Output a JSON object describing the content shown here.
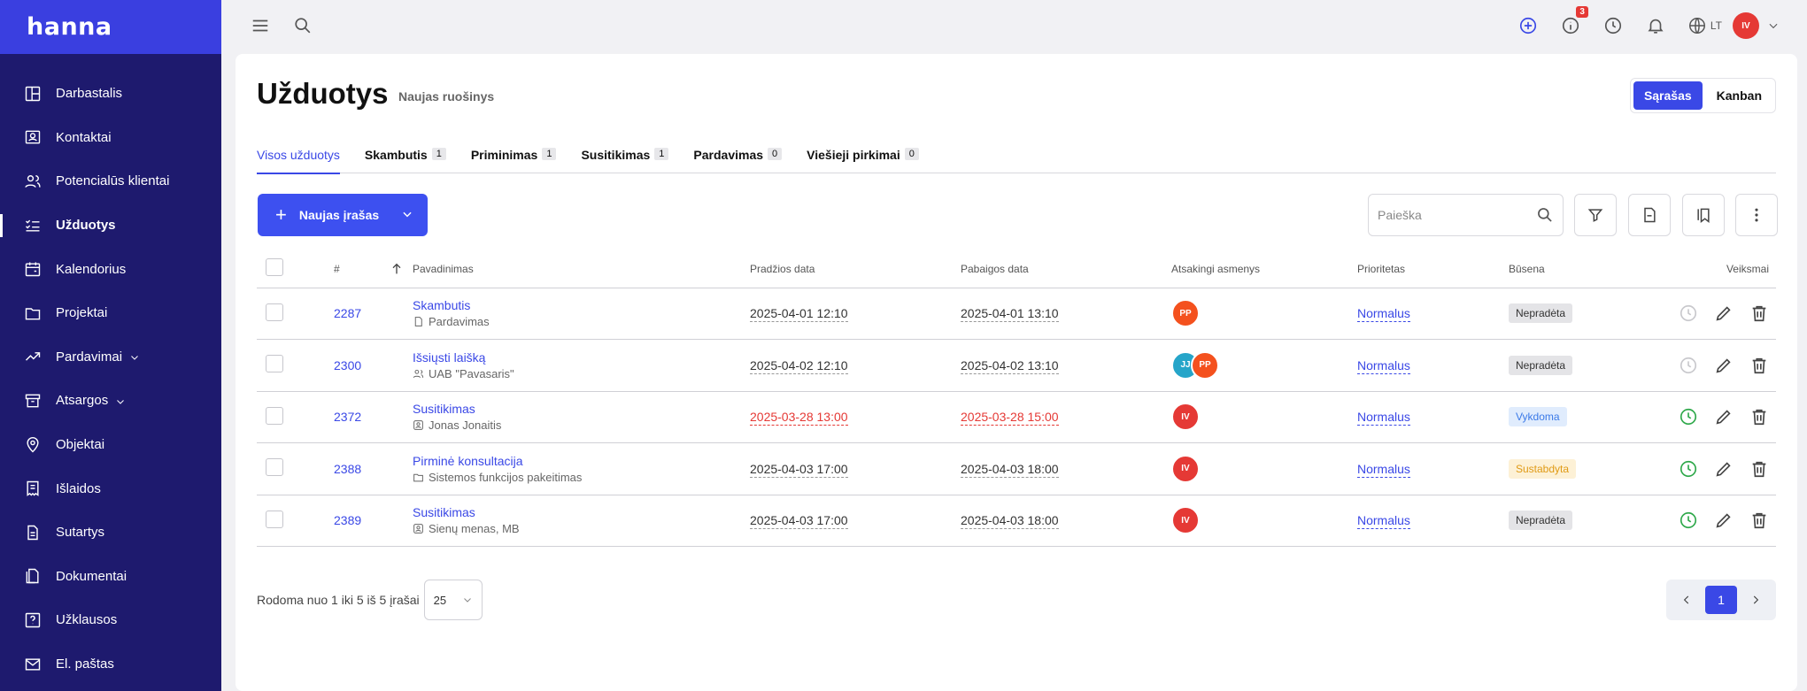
{
  "app": {
    "logo": "hanna"
  },
  "sidebar": {
    "items": [
      {
        "label": "Darbastalis",
        "icon": "dashboard-icon"
      },
      {
        "label": "Kontaktai",
        "icon": "contact-card-icon"
      },
      {
        "label": "Potencialūs klientai",
        "icon": "users-icon"
      },
      {
        "label": "Užduotys",
        "icon": "checklist-icon",
        "active": true
      },
      {
        "label": "Kalendorius",
        "icon": "calendar-icon"
      },
      {
        "label": "Projektai",
        "icon": "folder-icon"
      },
      {
        "label": "Pardavimai",
        "icon": "trend-up-icon",
        "expandable": true
      },
      {
        "label": "Atsargos",
        "icon": "archive-icon",
        "expandable": true
      },
      {
        "label": "Objektai",
        "icon": "map-pin-icon"
      },
      {
        "label": "Išlaidos",
        "icon": "receipt-icon"
      },
      {
        "label": "Sutartys",
        "icon": "document-icon"
      },
      {
        "label": "Dokumentai",
        "icon": "documents-icon"
      },
      {
        "label": "Užklausos",
        "icon": "help-icon"
      },
      {
        "label": "El. paštas",
        "icon": "mail-icon"
      }
    ]
  },
  "topbar": {
    "notification_count": "3",
    "lang": "LT",
    "user_initials": "IV"
  },
  "page": {
    "title": "Užduotys",
    "subtitle": "Naujas ruošinys",
    "view_list": "Sąrašas",
    "view_kanban": "Kanban"
  },
  "tabs": [
    {
      "label": "Visos užduotys",
      "count": null
    },
    {
      "label": "Skambutis",
      "count": "1"
    },
    {
      "label": "Priminimas",
      "count": "1"
    },
    {
      "label": "Susitikimas",
      "count": "1"
    },
    {
      "label": "Pardavimas",
      "count": "0"
    },
    {
      "label": "Viešieji pirkimai",
      "count": "0"
    }
  ],
  "toolbar": {
    "new_label": "Naujas įrašas",
    "search_placeholder": "Paieška"
  },
  "table": {
    "headers": {
      "num": "#",
      "title": "Pavadinimas",
      "start": "Pradžios data",
      "end": "Pabaigos data",
      "resp": "Atsakingi asmenys",
      "priority": "Prioritetas",
      "status": "Būsena",
      "actions": "Veiksmai"
    },
    "rows": [
      {
        "id": "2287",
        "title": "Skambutis",
        "sub": "Pardavimas",
        "sub_icon": "file-icon",
        "start": "2025-04-01 12:10",
        "end": "2025-04-01 13:10",
        "overdue": false,
        "assignees": [
          "PP"
        ],
        "priority": "Normalus",
        "status": "Nepradėta",
        "status_color": "gray",
        "timer_active": false
      },
      {
        "id": "2300",
        "title": "Išsiųsti laišką",
        "sub": "UAB \"Pavasaris\"",
        "sub_icon": "users-icon",
        "start": "2025-04-02 12:10",
        "end": "2025-04-02 13:10",
        "overdue": false,
        "assignees": [
          "JJ",
          "PP"
        ],
        "priority": "Normalus",
        "status": "Nepradėta",
        "status_color": "gray",
        "timer_active": false
      },
      {
        "id": "2372",
        "title": "Susitikimas",
        "sub": "Jonas Jonaitis",
        "sub_icon": "contact-icon",
        "start": "2025-03-28 13:00",
        "end": "2025-03-28 15:00",
        "overdue": true,
        "assignees": [
          "IV"
        ],
        "priority": "Normalus",
        "status": "Vykdoma",
        "status_color": "blue",
        "timer_active": true
      },
      {
        "id": "2388",
        "title": "Pirminė konsultacija",
        "sub": "Sistemos funkcijos pakeitimas",
        "sub_icon": "folder-icon",
        "start": "2025-04-03 17:00",
        "end": "2025-04-03 18:00",
        "overdue": false,
        "assignees": [
          "IV"
        ],
        "priority": "Normalus",
        "status": "Sustabdyta",
        "status_color": "yellow",
        "timer_active": true
      },
      {
        "id": "2389",
        "title": "Susitikimas",
        "sub": "Sienų menas, MB",
        "sub_icon": "contact-icon",
        "start": "2025-04-03 17:00",
        "end": "2025-04-03 18:00",
        "overdue": false,
        "assignees": [
          "IV"
        ],
        "priority": "Normalus",
        "status": "Nepradėta",
        "status_color": "gray",
        "timer_active": true
      }
    ]
  },
  "pagination": {
    "info": "Rodoma nuo 1 iki 5 iš 5 įrašai",
    "page_size": "25",
    "current_page": "1"
  }
}
